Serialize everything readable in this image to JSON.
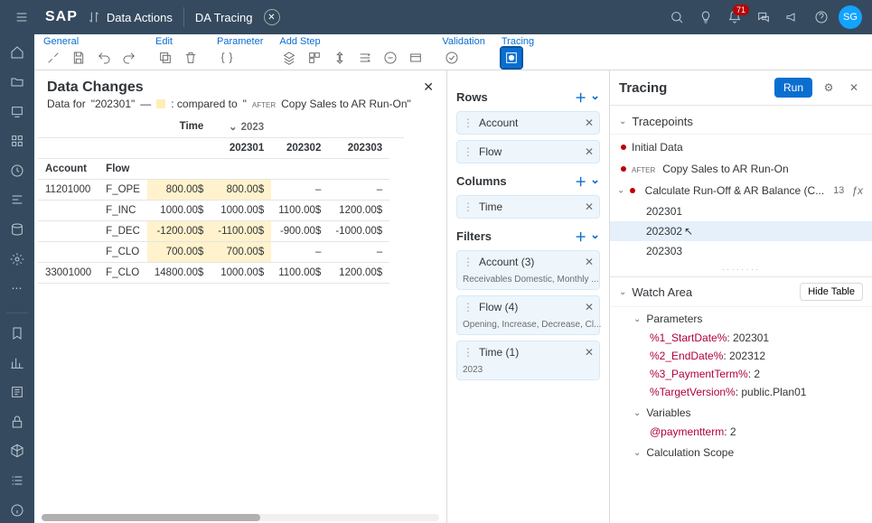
{
  "shell": {
    "logo": "SAP",
    "crumb1": "Data Actions",
    "crumb2": "DA Tracing",
    "notif_count": "71",
    "avatar": "SG"
  },
  "toolbar": {
    "groups": {
      "general": "General",
      "edit": "Edit",
      "parameter": "Parameter",
      "addstep": "Add Step",
      "validation": "Validation",
      "tracing": "Tracing"
    }
  },
  "data_changes": {
    "title": "Data Changes",
    "sub_prefix": "Data for",
    "period": "\"202301\"",
    "dash": "—",
    "compared": ": compared to",
    "quote": "\"",
    "after": "AFTER",
    "step": "Copy Sales to AR Run-On\"",
    "year_label": "2023",
    "col_time": "Time",
    "cols": [
      "202301",
      "202302",
      "202303"
    ],
    "row_headers": {
      "account": "Account",
      "flow": "Flow"
    },
    "rows": [
      {
        "acct": "11201000",
        "flow": "F_OPE",
        "hl": true,
        "vals": [
          "800.00$",
          "800.00$",
          "–",
          "–"
        ]
      },
      {
        "acct": "",
        "flow": "F_INC",
        "hl": false,
        "vals": [
          "1000.00$",
          "1000.00$",
          "1100.00$",
          "1200.00$"
        ]
      },
      {
        "acct": "",
        "flow": "F_DEC",
        "hl": true,
        "vals": [
          "-1200.00$",
          "-1100.00$",
          "-900.00$",
          "-1000.00$"
        ]
      },
      {
        "acct": "",
        "flow": "F_CLO",
        "hl": true,
        "vals": [
          "700.00$",
          "700.00$",
          "–",
          "–"
        ]
      },
      {
        "acct": "33001000",
        "flow": "F_CLO",
        "hl": false,
        "vals": [
          "14800.00$",
          "1000.00$",
          "1100.00$",
          "1200.00$"
        ]
      }
    ]
  },
  "builder": {
    "rows_title": "Rows",
    "columns_title": "Columns",
    "filters_title": "Filters",
    "rows": [
      {
        "label": "Account"
      },
      {
        "label": "Flow"
      }
    ],
    "columns": [
      {
        "label": "Time"
      }
    ],
    "filters": [
      {
        "label": "Account (3)",
        "sub": "Receivables Domestic, Monthly ..."
      },
      {
        "label": "Flow (4)",
        "sub": "Opening, Increase, Decrease, Cl..."
      },
      {
        "label": "Time (1)",
        "sub": "2023"
      }
    ]
  },
  "tracing": {
    "title": "Tracing",
    "run": "Run",
    "tracepoints_title": "Tracepoints",
    "tp_initial": "Initial Data",
    "tp_after": "AFTER",
    "tp_copy": "Copy Sales to AR Run-On",
    "tp_calc": "Calculate Run-Off & AR Balance (C...",
    "tp_calc_count": "13",
    "periods": [
      "202301",
      "202302",
      "202303"
    ],
    "watch_title": "Watch Area",
    "hide": "Hide Table",
    "params_title": "Parameters",
    "params": [
      {
        "k": "%1_StartDate%",
        "v": ": 202301"
      },
      {
        "k": "%2_EndDate%",
        "v": ": 202312"
      },
      {
        "k": "%3_PaymentTerm%",
        "v": ": 2"
      },
      {
        "k": "%TargetVersion%",
        "v": ": public.Plan01"
      }
    ],
    "vars_title": "Variables",
    "vars": [
      {
        "k": "@paymentterm",
        "v": ": 2"
      }
    ],
    "scope_title": "Calculation Scope"
  }
}
